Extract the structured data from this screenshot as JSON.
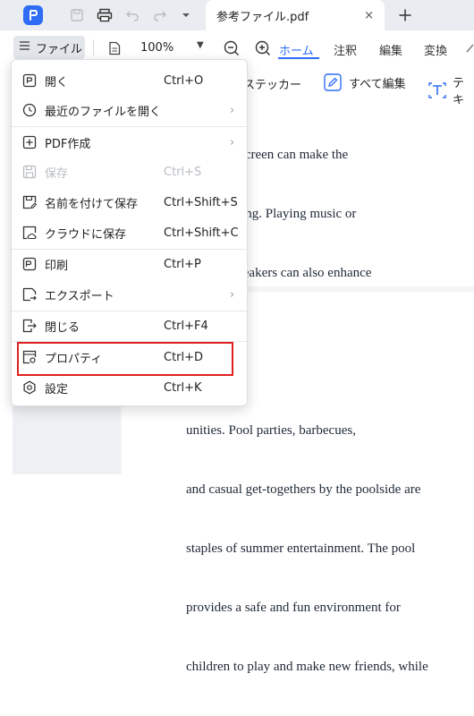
{
  "titlebar": {
    "tab_title": "参考ファイル.pdf",
    "tab_close": "×",
    "new_tab": "+"
  },
  "toolbar": {
    "file_menu_label": "ファイル",
    "zoom": "100%",
    "tabs": [
      "ホーム",
      "注釈",
      "編集",
      "変換"
    ]
  },
  "ribbon": {
    "sticker_label": "ステッカー",
    "edit_all_label": "すべて編集",
    "text_label": "テキ"
  },
  "file_menu": {
    "items": [
      {
        "label": "開く",
        "shortcut": "Ctrl+O",
        "icon": "open-icon"
      },
      {
        "label": "最近のファイルを開く",
        "shortcut": "",
        "icon": "clock-icon",
        "submenu": true
      },
      {
        "label": "PDF作成",
        "shortcut": "",
        "icon": "pdf-create-icon",
        "submenu": true
      },
      {
        "label": "保存",
        "shortcut": "Ctrl+S",
        "icon": "save-icon",
        "disabled": true
      },
      {
        "label": "名前を付けて保存",
        "shortcut": "Ctrl+Shift+S",
        "icon": "save-as-icon"
      },
      {
        "label": "クラウドに保存",
        "shortcut": "Ctrl+Shift+C",
        "icon": "cloud-save-icon"
      },
      {
        "label": "印刷",
        "shortcut": "Ctrl+P",
        "icon": "print-icon"
      },
      {
        "label": "エクスポート",
        "shortcut": "",
        "icon": "export-icon",
        "submenu": true
      },
      {
        "label": "閉じる",
        "shortcut": "Ctrl+F4",
        "icon": "close-file-icon"
      },
      {
        "label": "プロパティ",
        "shortcut": "Ctrl+D",
        "icon": "properties-icon",
        "highlighted": true
      },
      {
        "label": "設定",
        "shortcut": "Ctrl+K",
        "icon": "settings-icon"
      }
    ],
    "submenu_arrow": "›"
  },
  "document": {
    "page1_lines": [
      "ls and sunscreen can make the",
      "more inviting. Playing music or",
      "outdoor speakers can also enhance"
    ],
    "page2_lines": [
      "unities. Pool parties, barbecues,",
      "and casual get-togethers by the poolside are",
      "staples of summer entertainment. The pool",
      "provides a safe and fun environment for",
      "children to play and make new friends, while"
    ]
  },
  "colors": {
    "accent": "#2e6cf6",
    "highlight_border": "#e02020",
    "titlebar_bg": "#e9ecf1"
  }
}
